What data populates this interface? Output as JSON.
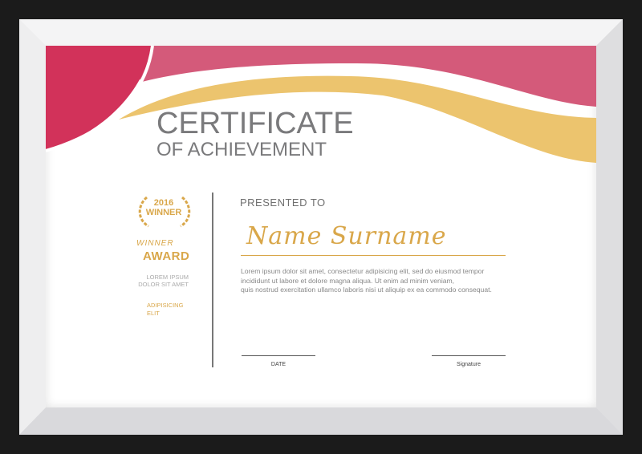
{
  "certificate": {
    "title": "CERTIFICATE",
    "subtitle": "OF ACHIEVEMENT",
    "badge_year": "2016",
    "badge_label": "WINNER",
    "winner": "WINNER",
    "award": "AWARD",
    "lorem_lines": [
      "LOREM IPSUM",
      "DOLOR SIT AMET"
    ],
    "adip_lines": [
      "ADIPISICING",
      "ELIT"
    ],
    "presented_to": "PRESENTED TO",
    "name": "Name Surname",
    "body_lines": [
      "Lorem ipsum dolor sit amet, consectetur adipisicing elit, sed do eiusmod tempor",
      "incididunt ut labore et dolore magna aliqua. Ut enim ad minim veniam,",
      "quis nostrud exercitation ullamco laboris nisi ut aliquip ex ea commodo consequat."
    ],
    "date_label": "DATE",
    "signature_label": "Signature"
  },
  "colors": {
    "red": "#d2325a",
    "pink": "#d45a7a",
    "gold": "#ecc46e",
    "text_gold": "#d9a74a",
    "gray": "#7a7a7c"
  }
}
